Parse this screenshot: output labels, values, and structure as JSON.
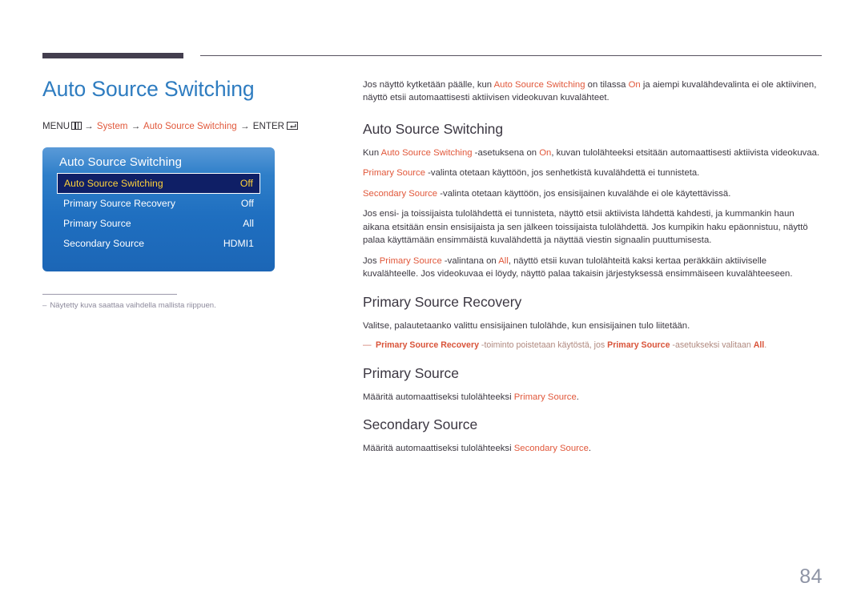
{
  "document": {
    "page_number": "84"
  },
  "left": {
    "title": "Auto Source Switching",
    "menu_path": {
      "prefix": "MENU",
      "menu_icon": "menu-icon",
      "arrow": "→",
      "item1": "System",
      "item2": "Auto Source Switching",
      "enter_label": "ENTER",
      "enter_icon": "enter-icon"
    },
    "osd": {
      "title": "Auto Source Switching",
      "rows": [
        {
          "label": "Auto Source Switching",
          "value": "Off",
          "selected": true
        },
        {
          "label": "Primary Source Recovery",
          "value": "Off",
          "selected": false
        },
        {
          "label": "Primary Source",
          "value": "All",
          "selected": false
        },
        {
          "label": "Secondary Source",
          "value": "HDMI1",
          "selected": false
        }
      ]
    },
    "footnote": {
      "dash": "–",
      "text": "Näytetty kuva saattaa vaihdella mallista riippuen."
    }
  },
  "right": {
    "intro": {
      "p1_a": "Jos näyttö kytketään päälle, kun ",
      "p1_hl1": "Auto Source Switching",
      "p1_b": " on tilassa ",
      "p1_hl2": "On",
      "p1_c": " ja aiempi kuvalähdevalinta ei ole aktiivinen, näyttö etsii automaattisesti aktiivisen videokuvan kuvalähteet."
    },
    "sections": [
      {
        "heading": "Auto Source Switching",
        "p1_a": "Kun ",
        "p1_hl1": "Auto Source Switching",
        "p1_b": " -asetuksena on ",
        "p1_hl2": "On",
        "p1_c": ", kuvan tulolähteeksi etsitään automaattisesti aktiivista videokuvaa.",
        "p2_hl": "Primary Source",
        "p2_rest": " -valinta otetaan käyttöön, jos senhetkistä kuvalähdettä ei tunnisteta.",
        "p3_hl": "Secondary Source",
        "p3_rest": " -valinta otetaan käyttöön, jos ensisijainen kuvalähde ei ole käytettävissä.",
        "p4": "Jos ensi- ja toissijaista tulolähdettä ei tunnisteta, näyttö etsii aktiivista lähdettä kahdesti, ja kummankin haun aikana etsitään ensin ensisijaista ja sen jälkeen toissijaista tulolähdettä. Jos kumpikin haku epäonnistuu, näyttö palaa käyttämään ensimmäistä kuvalähdettä ja näyttää viestin signaalin puuttumisesta.",
        "p5_a": "Jos ",
        "p5_hl1": "Primary Source",
        "p5_b": " -valintana on ",
        "p5_hl2": "All",
        "p5_c": ", näyttö etsii kuvan tulolähteitä kaksi kertaa peräkkäin aktiiviselle kuvalähteelle. Jos videokuvaa ei löydy, näyttö palaa takaisin järjestyksessä ensimmäiseen kuvalähteeseen."
      },
      {
        "heading": "Primary Source Recovery",
        "p1": "Valitse, palautetaanko valittu ensisijainen tulolähde, kun ensisijainen tulo liitetään.",
        "note_dash": "—",
        "note_hl1": "Primary Source Recovery",
        "note_mid": " -toiminto poistetaan käytöstä, jos ",
        "note_hl2": "Primary Source",
        "note_end": " -asetukseksi valitaan ",
        "note_hl3": "All",
        "note_period": "."
      },
      {
        "heading": "Primary Source",
        "p1_a": "Määritä automaattiseksi tulolähteeksi ",
        "p1_hl": "Primary Source",
        "p1_b": "."
      },
      {
        "heading": "Secondary Source",
        "p1_a": "Määritä automaattiseksi tulolähteeksi ",
        "p1_hl": "Secondary Source",
        "p1_b": "."
      }
    ]
  },
  "colors": {
    "title_blue": "#2e7cc0",
    "accent_orange": "#e1573a",
    "osd_selected_bg": "#0f1f66",
    "osd_selected_text": "#ffd23a",
    "rule_dark": "#433e4e",
    "page_number": "#8e94a5"
  }
}
